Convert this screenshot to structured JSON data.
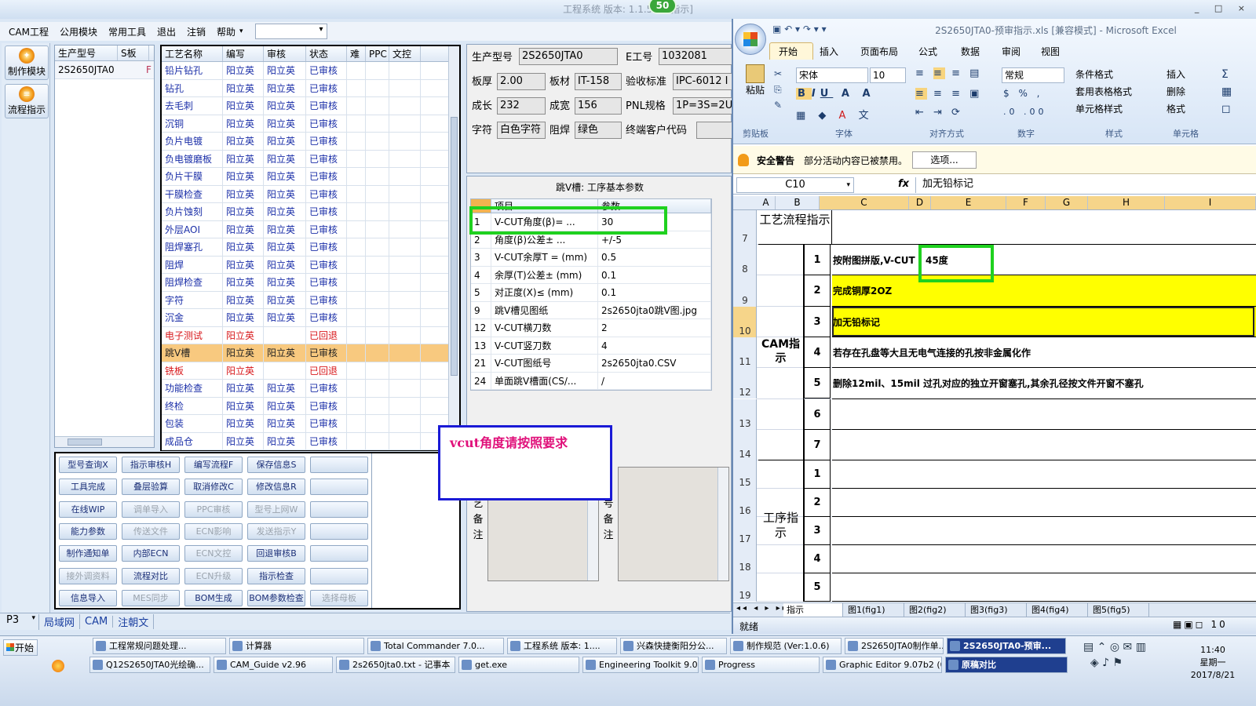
{
  "window": {
    "title": "工程系统   版本: 1.1.51.4",
    "title_suffix": "指示]",
    "badge": "50",
    "controls": "_ □ ×"
  },
  "menu": {
    "items": [
      "CAM工程",
      "公用模块",
      "常用工具",
      "退出",
      "注销",
      "帮助"
    ],
    "combo_value": ""
  },
  "leftnav": {
    "items": [
      "制作模块",
      "流程指示"
    ]
  },
  "model_list": {
    "headers": [
      "生产型号",
      "S板"
    ],
    "rows": [
      {
        "model": "2S2650JTA0",
        "flag": "F"
      }
    ]
  },
  "process": {
    "headers": [
      "工艺名称",
      "编写",
      "审核",
      "状态",
      "难",
      "PPC",
      "文控"
    ],
    "rows": [
      {
        "name": "铅片钻孔",
        "writer": "阳立英",
        "reviewer": "阳立英",
        "status": "已审核",
        "kind": "normal"
      },
      {
        "name": "钻孔",
        "writer": "阳立英",
        "reviewer": "阳立英",
        "status": "已审核",
        "kind": "normal"
      },
      {
        "name": "去毛刺",
        "writer": "阳立英",
        "reviewer": "阳立英",
        "status": "已审核",
        "kind": "normal"
      },
      {
        "name": "沉铜",
        "writer": "阳立英",
        "reviewer": "阳立英",
        "status": "已审核",
        "kind": "normal"
      },
      {
        "name": "负片电镀",
        "writer": "阳立英",
        "reviewer": "阳立英",
        "status": "已审核",
        "kind": "normal"
      },
      {
        "name": "负电镀磨板",
        "writer": "阳立英",
        "reviewer": "阳立英",
        "status": "已审核",
        "kind": "normal"
      },
      {
        "name": "负片干膜",
        "writer": "阳立英",
        "reviewer": "阳立英",
        "status": "已审核",
        "kind": "normal"
      },
      {
        "name": "干膜检查",
        "writer": "阳立英",
        "reviewer": "阳立英",
        "status": "已审核",
        "kind": "normal"
      },
      {
        "name": "负片蚀刻",
        "writer": "阳立英",
        "reviewer": "阳立英",
        "status": "已审核",
        "kind": "normal"
      },
      {
        "name": "外层AOI",
        "writer": "阳立英",
        "reviewer": "阳立英",
        "status": "已审核",
        "kind": "normal"
      },
      {
        "name": "阻焊塞孔",
        "writer": "阳立英",
        "reviewer": "阳立英",
        "status": "已审核",
        "kind": "normal"
      },
      {
        "name": "阻焊",
        "writer": "阳立英",
        "reviewer": "阳立英",
        "status": "已审核",
        "kind": "normal"
      },
      {
        "name": "阻焊检查",
        "writer": "阳立英",
        "reviewer": "阳立英",
        "status": "已审核",
        "kind": "normal"
      },
      {
        "name": "字符",
        "writer": "阳立英",
        "reviewer": "阳立英",
        "status": "已审核",
        "kind": "normal"
      },
      {
        "name": "沉金",
        "writer": "阳立英",
        "reviewer": "阳立英",
        "status": "已审核",
        "kind": "normal"
      },
      {
        "name": "电子测试",
        "writer": "阳立英",
        "reviewer": "",
        "status": "已回退",
        "kind": "red"
      },
      {
        "name": "跳V槽",
        "writer": "阳立英",
        "reviewer": "阳立英",
        "status": "已审核",
        "kind": "sel"
      },
      {
        "name": "铣板",
        "writer": "阳立英",
        "reviewer": "",
        "status": "已回退",
        "kind": "red"
      },
      {
        "name": "功能检查",
        "writer": "阳立英",
        "reviewer": "阳立英",
        "status": "已审核",
        "kind": "normal"
      },
      {
        "name": "终检",
        "writer": "阳立英",
        "reviewer": "阳立英",
        "status": "已审核",
        "kind": "normal"
      },
      {
        "name": "包装",
        "writer": "阳立英",
        "reviewer": "阳立英",
        "status": "已审核",
        "kind": "normal"
      },
      {
        "name": "成品仓",
        "writer": "阳立英",
        "reviewer": "阳立英",
        "status": "已审核",
        "kind": "normal"
      }
    ]
  },
  "buttons": [
    {
      "label": "型号查询X",
      "enabled": true
    },
    {
      "label": "指示审核H",
      "enabled": true
    },
    {
      "label": "编写流程F",
      "enabled": true
    },
    {
      "label": "保存信息S",
      "enabled": true
    },
    {
      "label": "",
      "enabled": true
    },
    {
      "label": "工具完成",
      "enabled": true
    },
    {
      "label": "叠层验算",
      "enabled": true
    },
    {
      "label": "取消修改C",
      "enabled": true
    },
    {
      "label": "修改信息R",
      "enabled": true
    },
    {
      "label": "",
      "enabled": true
    },
    {
      "label": "在线WIP",
      "enabled": true
    },
    {
      "label": "调单导入",
      "enabled": false
    },
    {
      "label": "PPC审核",
      "enabled": false
    },
    {
      "label": "型号上网W",
      "enabled": false
    },
    {
      "label": "",
      "enabled": true
    },
    {
      "label": "能力参数",
      "enabled": true
    },
    {
      "label": "传送文件",
      "enabled": false
    },
    {
      "label": "ECN影响",
      "enabled": false
    },
    {
      "label": "发送指示Y",
      "enabled": false
    },
    {
      "label": "",
      "enabled": true
    },
    {
      "label": "制作通知单",
      "enabled": true
    },
    {
      "label": "内部ECN",
      "enabled": true
    },
    {
      "label": "ECN文控",
      "enabled": false
    },
    {
      "label": "回退审核B",
      "enabled": true
    },
    {
      "label": "",
      "enabled": true
    },
    {
      "label": "接外调资料",
      "enabled": false
    },
    {
      "label": "流程对比",
      "enabled": true
    },
    {
      "label": "ECN升级",
      "enabled": false
    },
    {
      "label": "指示检查",
      "enabled": true
    },
    {
      "label": "",
      "enabled": true
    },
    {
      "label": "信息导入",
      "enabled": true
    },
    {
      "label": "MES同步",
      "enabled": false
    },
    {
      "label": "BOM生成",
      "enabled": true
    },
    {
      "label": "BOM参数检查",
      "enabled": true
    },
    {
      "label": "选择母板",
      "enabled": false
    }
  ],
  "info": {
    "prod_model_label": "生产型号",
    "prod_model": "2S2650JTA0",
    "eno_label": "E工号",
    "eno": "1032081",
    "thick_label": "板厚",
    "thick": "2.00",
    "mat_label": "板材",
    "mat": "IT-158",
    "accept_label": "验收标准",
    "accept": "IPC-6012 I",
    "grow_label": "成长",
    "grow": "232",
    "width_label": "成宽",
    "width": "156",
    "pnl_label": "PNL规格",
    "pnl": "1P=3S=2U",
    "char_label": "字符",
    "char": "白色字符",
    "mask_label": "阻焊",
    "mask": "绿色",
    "cust_label": "终端客户代码",
    "cust": ""
  },
  "vgroove": {
    "title": "跳V槽: 工序基本参数",
    "headers": [
      "项目",
      "参数"
    ],
    "rows": [
      {
        "no": "1",
        "item": "V-CUT角度(β)=   ...",
        "value": "30"
      },
      {
        "no": "2",
        "item": "角度(β)公差±   ...",
        "value": "+/-5"
      },
      {
        "no": "3",
        "item": "V-CUT余厚T =  (mm)",
        "value": "0.5"
      },
      {
        "no": "4",
        "item": "余厚(T)公差±  (mm)",
        "value": "0.1"
      },
      {
        "no": "5",
        "item": "对正度(X)≤ (mm)",
        "value": "0.1"
      },
      {
        "no": "9",
        "item": "跳V槽见图纸",
        "value": "2s2650jta0跳V图.jpg"
      },
      {
        "no": "12",
        "item": "V-CUT横刀数",
        "value": "2"
      },
      {
        "no": "13",
        "item": "V-CUT竖刀数",
        "value": "4"
      },
      {
        "no": "21",
        "item": "V-CUT图纸号",
        "value": "2s2650jta0.CSV"
      },
      {
        "no": "24",
        "item": "单面跳V槽面(CS/...",
        "value": "/"
      }
    ]
  },
  "annotation": "vcut角度请按照要求",
  "remarks": {
    "left_label": "艺备注",
    "right_label": "号备注"
  },
  "status_bar": {
    "combo": "P3",
    "tabs": [
      "局域网",
      "CAM",
      "注朝文"
    ]
  },
  "excel": {
    "title": "2S2650JTA0-预审指示.xls [兼容模式] - Microsoft Excel",
    "tabs": [
      "开始",
      "插入",
      "页面布局",
      "公式",
      "数据",
      "审阅",
      "视图"
    ],
    "font_name": "宋体",
    "font_size": "10",
    "number_format": "常规",
    "paste": "粘贴",
    "style_items": [
      "条件格式",
      "套用表格格式",
      "单元格样式"
    ],
    "cell_items": [
      "插入",
      "删除",
      "格式"
    ],
    "groups": [
      "剪贴板",
      "字体",
      "对齐方式",
      "数字",
      "样式",
      "单元格"
    ],
    "security": {
      "label": "安全警告",
      "msg": "部分活动内容已被禁用。",
      "btn": "选项..."
    },
    "name_box": "C10",
    "formula": "加无铅标记",
    "columns": [
      "A",
      "B",
      "C",
      "D",
      "E",
      "F",
      "G",
      "H",
      "I"
    ],
    "row_numbers": [
      "7",
      "8",
      "9",
      "10",
      "11",
      "12",
      "13",
      "14",
      "15",
      "16",
      "17",
      "18",
      "19"
    ],
    "section_1": "工艺流程指示",
    "section_2": "CAM指示",
    "section_3": "工序指示",
    "cam_rows": [
      {
        "n": "1",
        "text": "按附图拼版,V-CUT",
        "hl": false
      },
      {
        "n": "2",
        "text": "完成铜厚2OZ",
        "hl": true
      },
      {
        "n": "3",
        "text": "加无铅标记",
        "hl": true
      },
      {
        "n": "4",
        "text": "若存在孔盘等大且无电气连接的孔按非金属化作",
        "hl": false
      },
      {
        "n": "5",
        "text": "删除12mil、15mil 过孔对应的独立开窗塞孔,其余孔径按文件开窗不塞孔",
        "hl": false
      },
      {
        "n": "6",
        "text": "",
        "hl": false
      },
      {
        "n": "7",
        "text": "",
        "hl": false
      }
    ],
    "proc_rows": [
      "1",
      "2",
      "3",
      "4",
      "5"
    ],
    "vcut_note": "45度",
    "sheet_tabs": [
      "指示",
      "图1(fig1)",
      "图2(fig2)",
      "图3(fig3)",
      "图4(fig4)",
      "图5(fig5)"
    ],
    "status": "就绪"
  },
  "taskbar": {
    "start": "开始",
    "row1": [
      "工程常规问题处理...",
      "计算器",
      "Total Commander 7.0...",
      "工程系统  版本: 1....",
      "兴森快捷衡阳分公...",
      "制作规范 (Ver:1.0.6)",
      "2S2650JTA0制作单...",
      "2S2650JTA0-预审..."
    ],
    "row2": [
      "Q12S2650JTA0光绘确...",
      "CAM_Guide v2.96",
      "2s2650jta0.txt - 记事本",
      "get.exe",
      "Engineering Toolkit 9.07...",
      "Progress",
      "Graphic Editor 9.07b2 (0...",
      "原稿对比"
    ],
    "time": "11:40",
    "day": "星期一",
    "date": "2017/8/21"
  },
  "colors": {
    "highlight_green": "#1fd11f",
    "selected_row": "#f8c97f",
    "excel_yellow": "#ffff00",
    "annotation_border": "#1a1ad6",
    "annotation_text": "#e0107a"
  }
}
